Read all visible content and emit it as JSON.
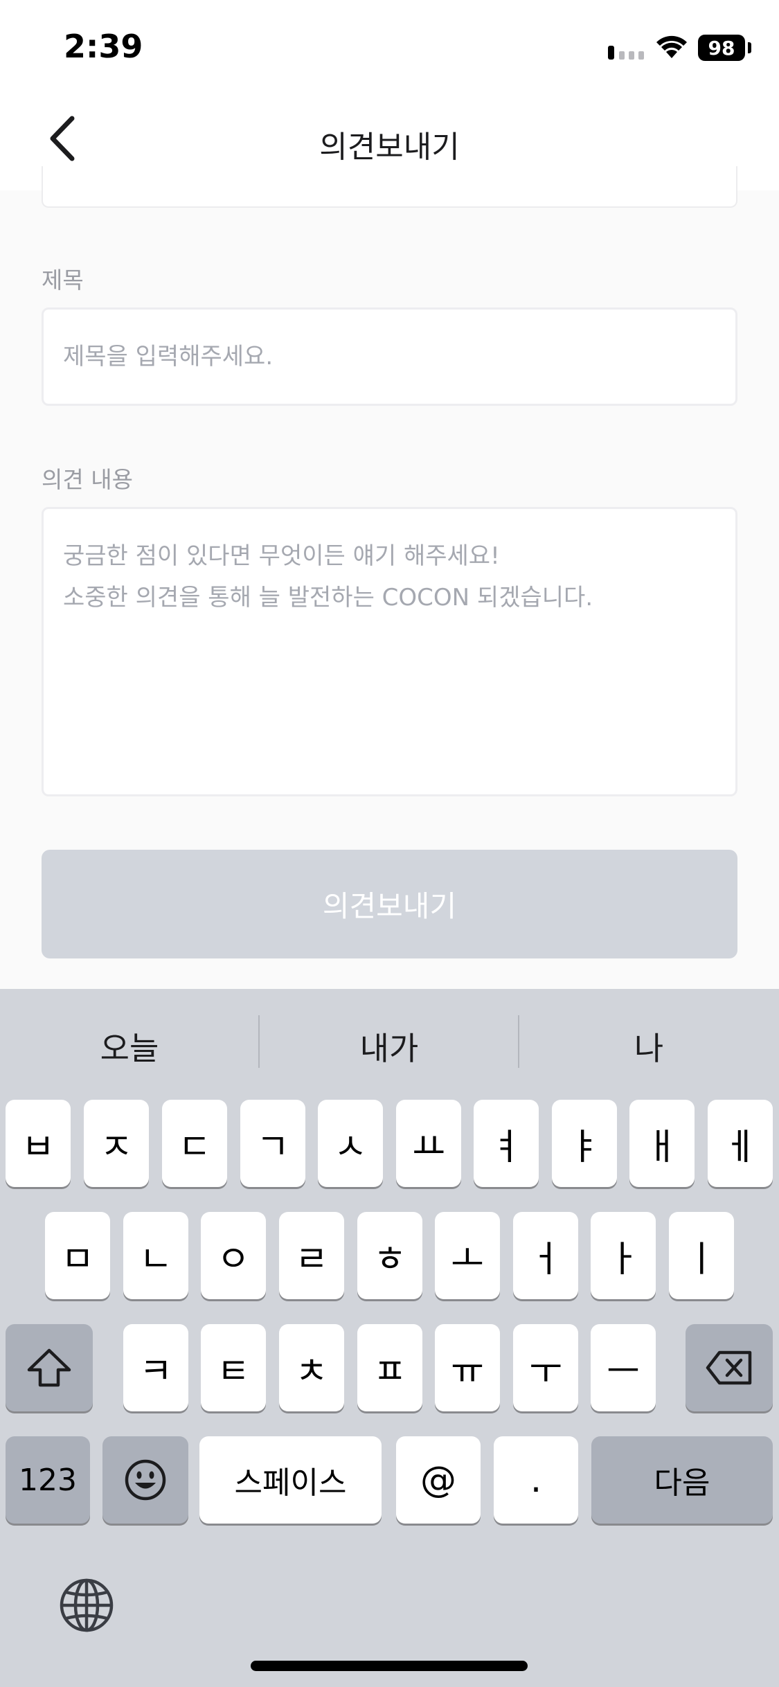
{
  "status_bar": {
    "time": "2:39",
    "battery": "98"
  },
  "nav": {
    "title": "의견보내기",
    "back_icon": "chevron-left-icon"
  },
  "form": {
    "title_label": "제목",
    "title_placeholder": "제목을 입력해주세요.",
    "title_value": "",
    "content_label": "의견 내용",
    "content_placeholder": "궁금한 점이 있다면 무엇이든 얘기 해주세요!\n소중한 의견을 통해 늘 발전하는 COCON 되겠습니다.",
    "content_value": "",
    "submit_label": "의견보내기",
    "submit_enabled": false,
    "submit_color": "#d1d5dc"
  },
  "keyboard": {
    "suggestions": [
      "오늘",
      "내가",
      "나"
    ],
    "row1": [
      "ㅂ",
      "ㅈ",
      "ㄷ",
      "ㄱ",
      "ㅅ",
      "ㅛ",
      "ㅕ",
      "ㅑ",
      "ㅐ",
      "ㅔ"
    ],
    "row2": [
      "ㅁ",
      "ㄴ",
      "ㅇ",
      "ㄹ",
      "ㅎ",
      "ㅗ",
      "ㅓ",
      "ㅏ",
      "ㅣ"
    ],
    "row3": [
      "ㅋ",
      "ㅌ",
      "ㅊ",
      "ㅍ",
      "ㅠ",
      "ㅜ",
      "ㅡ"
    ],
    "numbers_key": "123",
    "emoji_icon": "emoji-icon",
    "space_key": "스페이스",
    "at_key": "@",
    "period_key": ".",
    "return_key": "다음",
    "shift_icon": "shift-icon",
    "delete_icon": "delete-icon",
    "globe_icon": "globe-icon"
  }
}
